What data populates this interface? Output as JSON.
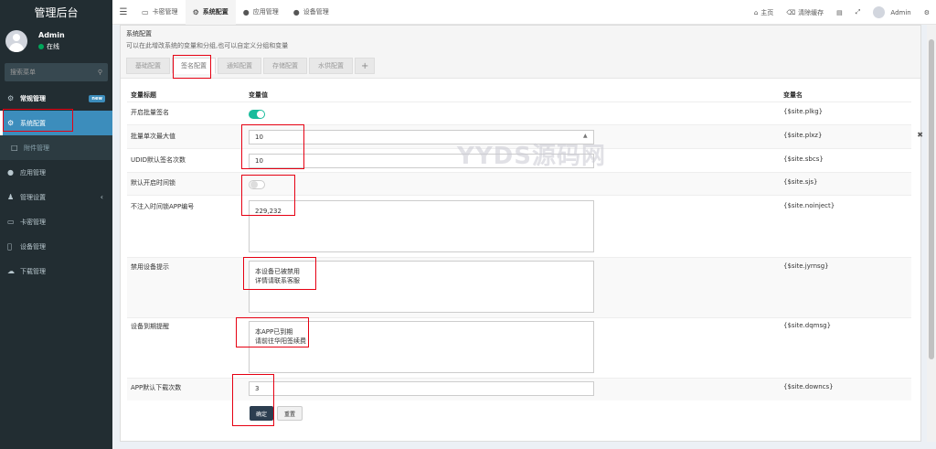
{
  "app": {
    "title": "管理后台"
  },
  "user": {
    "name": "Admin",
    "status": "在线"
  },
  "sidebar": {
    "search_placeholder": "搜索菜单",
    "items": [
      {
        "label": "常规管理",
        "badge": "new",
        "icon": "cogs-icon"
      },
      {
        "label": "系统配置",
        "icon": "gear-icon"
      },
      {
        "label": "附件管理",
        "icon": "file-icon"
      },
      {
        "label": "应用管理",
        "icon": "circle-icon"
      },
      {
        "label": "管理设置",
        "icon": "users-icon"
      },
      {
        "label": "卡密管理",
        "icon": "card-icon"
      },
      {
        "label": "设备管理",
        "icon": "apple-icon"
      },
      {
        "label": "下载管理",
        "icon": "cloud-download-icon"
      }
    ]
  },
  "topbar": {
    "tabs": [
      {
        "label": "卡密管理",
        "icon": "card-icon"
      },
      {
        "label": "系统配置",
        "icon": "gear-icon"
      },
      {
        "label": "应用管理",
        "icon": "circle-icon"
      },
      {
        "label": "设备管理",
        "icon": "apple-icon"
      }
    ],
    "right": {
      "home": "主页",
      "clear_cache": "清除缓存",
      "user": "Admin"
    }
  },
  "panel": {
    "title": "系统配置",
    "desc": "可以在此增改系统的变量和分组,也可以自定义分组和变量",
    "tabs": [
      "基础配置",
      "签名配置",
      "通知配置",
      "存储配置",
      "水供配置"
    ],
    "plus": "+"
  },
  "table": {
    "headers": {
      "title": "变量标题",
      "value": "变量值",
      "name": "变量名"
    },
    "rows": [
      {
        "label": "开启批量签名",
        "var": "{$site.plkg}",
        "type": "toggle",
        "on": true
      },
      {
        "label": "批量单次最大值",
        "var": "{$site.plxz}",
        "type": "input",
        "value": "10"
      },
      {
        "label": "UDID默认签名次数",
        "var": "{$site.sbcs}",
        "type": "input",
        "value": "10"
      },
      {
        "label": "默认开启时间锁",
        "var": "{$site.sjs}",
        "type": "toggle",
        "on": false
      },
      {
        "label": "不注入时间锁APP编号",
        "var": "{$site.noinject}",
        "type": "textarea",
        "value": "229,232"
      },
      {
        "label": "禁用设备提示",
        "var": "{$site.jyrnsg}",
        "type": "textarea",
        "value": "本设备已被禁用\n详情请联系客服"
      },
      {
        "label": "设备到期提醒",
        "var": "{$site.dqmsg}",
        "type": "textarea",
        "value": "本APP已到期\n请前往华阳签续费"
      },
      {
        "label": "APP默认下载次数",
        "var": "{$site.downcs}",
        "type": "input",
        "value": "3"
      }
    ]
  },
  "buttons": {
    "ok": "确定",
    "reset": "重置"
  },
  "watermark": "YYDS源码网",
  "colors": {
    "sidebar_bg": "#222d32",
    "active": "#3c8dbc",
    "toggle_on": "#18bc9c",
    "highlight_box": "#e60012"
  }
}
